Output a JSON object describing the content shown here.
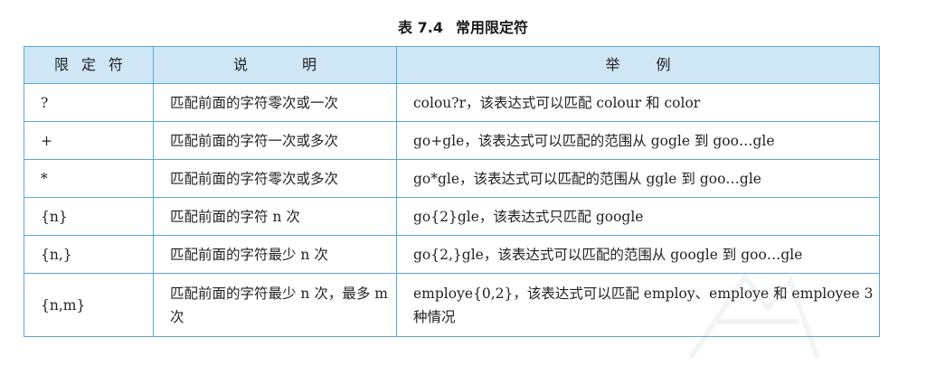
{
  "caption": {
    "number": "表 7.4",
    "title": "常用限定符"
  },
  "table": {
    "headers": [
      "限定符",
      "说明",
      "举例"
    ],
    "rows": [
      {
        "qualifier": "?",
        "description": "匹配前面的字符零次或一次",
        "example": "colou?r，该表达式可以匹配 colour 和 color"
      },
      {
        "qualifier": "+",
        "description": "匹配前面的字符一次或多次",
        "example": "go+gle，该表达式可以匹配的范围从 gogle 到 goo…gle"
      },
      {
        "qualifier": "*",
        "description": "匹配前面的字符零次或多次",
        "example": "go*gle，该表达式可以匹配的范围从 ggle 到 goo…gle"
      },
      {
        "qualifier": "{n}",
        "description": "匹配前面的字符 n 次",
        "example": "go{2}gle，该表达式只匹配 google"
      },
      {
        "qualifier": "{n,}",
        "description": "匹配前面的字符最少 n 次",
        "example": "go{2,}gle，该表达式可以匹配的范围从 google 到 goo…gle"
      },
      {
        "qualifier": "{n,m}",
        "description": "匹配前面的字符最少 n 次，最多 m 次",
        "example": "employe{0,2}，该表达式可以匹配 employ、employe 和 employee 3 种情况"
      }
    ]
  }
}
